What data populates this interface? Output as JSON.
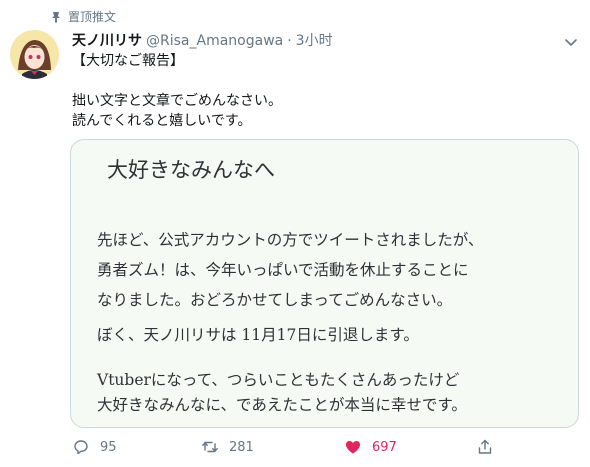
{
  "pinned": {
    "label": "置顶推文",
    "icon": "pin-icon"
  },
  "author": {
    "display_name": "天ノ川リサ",
    "handle": "@Risa_Amanogawa",
    "separator": "·",
    "time": "3小时"
  },
  "tweet": {
    "line1": "【大切なご報告】",
    "line2": "拙い文字と文章でごめんなさい。",
    "line3": "読んでくれると嬉しいです。"
  },
  "letter": {
    "title": "大好きなみんなへ",
    "lines": [
      "先ほど、公式アカウントの方でツイートされましたが、",
      "勇者ズム！は、今年いっぱいで活動を休止することに",
      "なりました。おどろかせてしまってごめんなさい。",
      "ぼく、天ノ川リサは 11月17日に引退します。",
      "Vtuberになって、つらいこともたくさんあったけど",
      "大好きなみんなに、であえたことが本当に幸せです。"
    ]
  },
  "actions": {
    "reply_count": "95",
    "retweet_count": "281",
    "like_count": "697",
    "like_color": "#e0245e"
  }
}
